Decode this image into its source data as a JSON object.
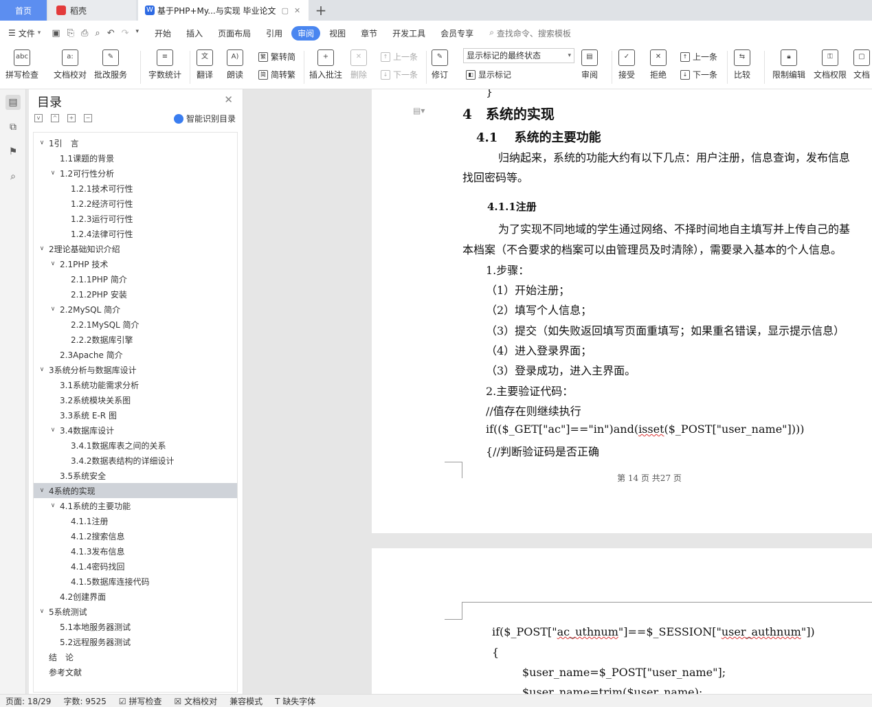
{
  "tabs": {
    "home": "首页",
    "daoke": "稻壳",
    "doc": "基于PHP+My...与实现 毕业论文",
    "plus": "+"
  },
  "menu": {
    "file": "文件",
    "items": [
      "开始",
      "插入",
      "页面布局",
      "引用",
      "审阅",
      "视图",
      "章节",
      "开发工具",
      "会员专享"
    ],
    "active": "审阅",
    "search": "查找命令、搜索模板"
  },
  "ribbon": {
    "spell": "拼写检查",
    "proof": "文档校对",
    "batch": "批改服务",
    "wordcount": "字数统计",
    "translate": "翻译",
    "read": "朗读",
    "trad": "繁转简",
    "simp": "简转繁",
    "insert_comment": "插入批注",
    "delete": "删除",
    "prev_comment": "上一条",
    "next_comment": "下一条",
    "track": "修订",
    "mark_state": "显示标记的最终状态",
    "show_marks": "显示标记",
    "review": "审阅",
    "accept": "接受",
    "reject": "拒绝",
    "prev_change": "上一条",
    "next_change": "下一条",
    "compare": "比较",
    "restrict": "限制编辑",
    "permission": "文档权限",
    "more": "文档"
  },
  "toc": {
    "title": "目录",
    "smart": "智能识别目录",
    "items": [
      {
        "label": "1引　言",
        "level": 0,
        "toggle": "v"
      },
      {
        "label": "1.1课题的背景",
        "level": 1,
        "toggle": ""
      },
      {
        "label": "1.2可行性分析",
        "level": 1,
        "toggle": "v"
      },
      {
        "label": "1.2.1技术可行性",
        "level": 2,
        "toggle": ""
      },
      {
        "label": "1.2.2经济可行性",
        "level": 2,
        "toggle": ""
      },
      {
        "label": "1.2.3运行可行性",
        "level": 2,
        "toggle": ""
      },
      {
        "label": "1.2.4法律可行性",
        "level": 2,
        "toggle": ""
      },
      {
        "label": "2理论基础知识介绍",
        "level": 0,
        "toggle": "v"
      },
      {
        "label": "2.1PHP 技术",
        "level": 1,
        "toggle": "v"
      },
      {
        "label": "2.1.1PHP 简介",
        "level": 2,
        "toggle": ""
      },
      {
        "label": "2.1.2PHP 安装",
        "level": 2,
        "toggle": ""
      },
      {
        "label": "2.2MySQL 简介",
        "level": 1,
        "toggle": "v"
      },
      {
        "label": "2.2.1MySQL 简介",
        "level": 2,
        "toggle": ""
      },
      {
        "label": "2.2.2数据库引擎",
        "level": 2,
        "toggle": ""
      },
      {
        "label": "2.3Apache 简介",
        "level": 1,
        "toggle": ""
      },
      {
        "label": "3系统分析与数据库设计",
        "level": 0,
        "toggle": "v"
      },
      {
        "label": "3.1系统功能需求分析",
        "level": 1,
        "toggle": ""
      },
      {
        "label": "3.2系统模块关系图",
        "level": 1,
        "toggle": ""
      },
      {
        "label": "3.3系统 E-R 图",
        "level": 1,
        "toggle": ""
      },
      {
        "label": "3.4数据库设计",
        "level": 1,
        "toggle": "v"
      },
      {
        "label": "3.4.1数据库表之间的关系",
        "level": 2,
        "toggle": ""
      },
      {
        "label": "3.4.2数据表结构的详细设计",
        "level": 2,
        "toggle": ""
      },
      {
        "label": "3.5系统安全",
        "level": 1,
        "toggle": ""
      },
      {
        "label": "4系统的实现",
        "level": 0,
        "toggle": "v",
        "selected": true
      },
      {
        "label": "4.1系统的主要功能",
        "level": 1,
        "toggle": "v"
      },
      {
        "label": "4.1.1注册",
        "level": 2,
        "toggle": ""
      },
      {
        "label": "4.1.2搜索信息",
        "level": 2,
        "toggle": ""
      },
      {
        "label": "4.1.3发布信息",
        "level": 2,
        "toggle": ""
      },
      {
        "label": "4.1.4密码找回",
        "level": 2,
        "toggle": ""
      },
      {
        "label": "4.1.5数据库连接代码",
        "level": 2,
        "toggle": ""
      },
      {
        "label": "4.2创建界面",
        "level": 1,
        "toggle": ""
      },
      {
        "label": "5系统测试",
        "level": 0,
        "toggle": "v"
      },
      {
        "label": "5.1本地服务器测试",
        "level": 1,
        "toggle": ""
      },
      {
        "label": "5.2远程服务器测试",
        "level": 1,
        "toggle": ""
      },
      {
        "label": "结　论",
        "level": 0,
        "toggle": ""
      },
      {
        "label": "参考文献",
        "level": 0,
        "toggle": ""
      }
    ]
  },
  "doc": {
    "brace": "}",
    "h1": "4　系统的实现",
    "h2": "4.1　 系统的主要功能",
    "p1a": "归纳起来，系统的功能大约有以下几点：用户注册，信息查询，发布信息",
    "p1b": "找回密码等。",
    "h3": "4.1.1注册",
    "p2a": "为了实现不同地域的学生通过网络、不择时间地自主填写并上传自己的基",
    "p2b": "本档案（不合要求的档案可以由管理员及时清除），需要录入基本的个人信息。",
    "steps": "1.步骤：",
    "s1": "（1）开始注册；",
    "s2": "（2）填写个人信息；",
    "s3": "（3）提交（如失败返回填写页面重填写；如果重名错误，显示提示信息）",
    "s4": "（4）进入登录界面；",
    "s5": "（3）登录成功，进入主界面。",
    "code_title": "2.主要验证代码：",
    "c1": "//值存在则继续执行",
    "c2_pre": "if(($_GET[\"ac\"]==\"in\")and(",
    "c2_sq": "isset",
    "c2_post": "($_POST[\"user_name\"])))",
    "c3": "{//判断验证码是否正确",
    "footer": "第 14 页 共27 页",
    "p2c1_pre": "if($_POST[\"",
    "p2c1_sq1": "ac_uthnum",
    "p2c1_mid": "\"]==$_SESSION[\"",
    "p2c1_sq2": "user_authnum",
    "p2c1_post": "\"])",
    "p2c2": "{",
    "p2c3": "$user_name=$_POST[\"user_name\"];",
    "p2c4": "$user_name=trim($user_name);"
  },
  "status": {
    "page": "页面: 18/29",
    "words": "字数: 9525",
    "spell": "拼写检查",
    "proof": "文档校对",
    "compat": "兼容模式",
    "font": "缺失字体"
  }
}
